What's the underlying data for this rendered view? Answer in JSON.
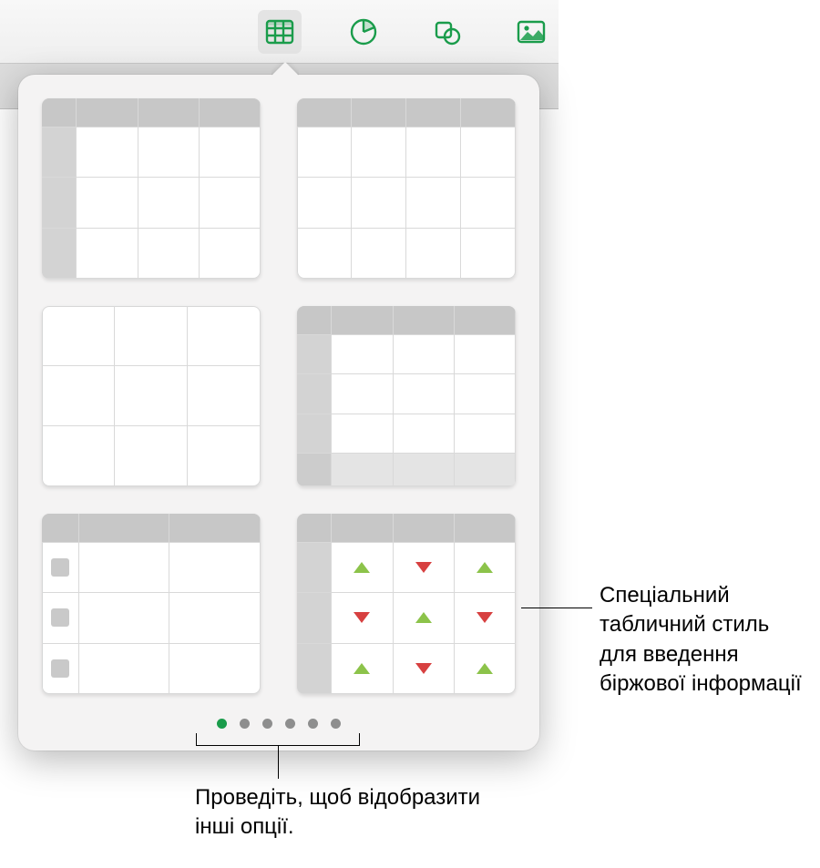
{
  "toolbar": {
    "items": [
      {
        "name": "insert-table-button",
        "icon": "table-icon",
        "active": true
      },
      {
        "name": "insert-chart-button",
        "icon": "pie-icon",
        "active": false
      },
      {
        "name": "insert-shape-button",
        "icon": "shape-icon",
        "active": false
      },
      {
        "name": "insert-media-button",
        "icon": "media-icon",
        "active": false
      }
    ]
  },
  "popover": {
    "page_count": 6,
    "active_page": 0,
    "styles": [
      {
        "name": "table-style-header-row-col"
      },
      {
        "name": "table-style-header-row"
      },
      {
        "name": "table-style-plain"
      },
      {
        "name": "table-style-header-footer"
      },
      {
        "name": "table-style-checklist"
      },
      {
        "name": "table-style-stock"
      }
    ],
    "stock_pattern": [
      [
        "up",
        "dn",
        "up"
      ],
      [
        "dn",
        "up",
        "dn"
      ],
      [
        "up",
        "dn",
        "up"
      ]
    ]
  },
  "callouts": {
    "stock": "Спеціальний табличний стиль для введення біржової інформації",
    "dots": "Проведіть, щоб відобразити інші опції."
  }
}
